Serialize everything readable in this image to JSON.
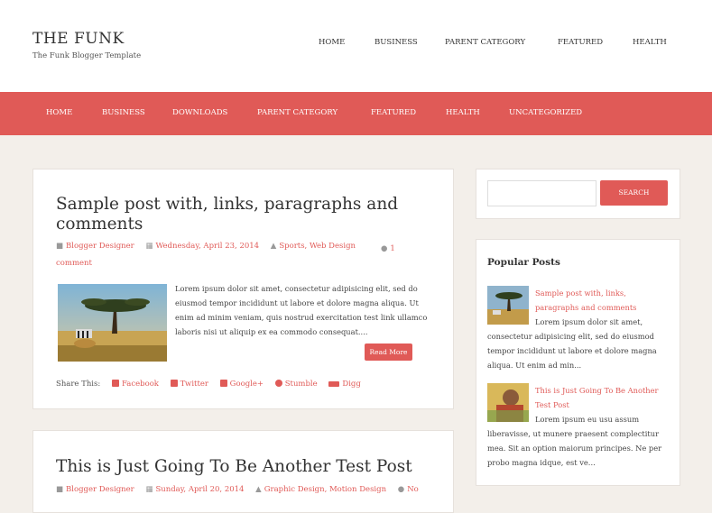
{
  "site": {
    "title": "THE FUNK",
    "description": "The Funk Blogger Template"
  },
  "top_nav": [
    "HOME",
    "BUSINESS",
    "PARENT CATEGORY",
    "FEATURED",
    "HEALTH"
  ],
  "main_nav": [
    "HOME",
    "BUSINESS",
    "DOWNLOADS",
    "PARENT CATEGORY",
    "FEATURED",
    "HEALTH",
    "UNCATEGORIZED"
  ],
  "posts": [
    {
      "title": "Sample post with, links, paragraphs and comments",
      "author": "Blogger Designer",
      "date": "Wednesday, April 23, 2014",
      "categories": "Sports, Web Design",
      "comments": "1 comment",
      "excerpt": "Lorem ipsum dolor sit amet, consectetur adipisicing elit, sed do eiusmod tempor incididunt ut labore et dolore magna aliqua. Ut enim ad minim veniam, quis nostrud exercitation test link ullamco laboris nisi ut aliquip ex ea commodo consequat....",
      "read_more": "Read More",
      "share_label": "Share This:",
      "share": [
        "Facebook",
        "Twitter",
        "Google+",
        "Stumble",
        "Digg"
      ]
    },
    {
      "title": "This is Just Going To Be Another Test Post",
      "author": "Blogger Designer",
      "date": "Sunday, April 20, 2014",
      "categories": "Graphic Design, Motion Design",
      "comments": "No"
    }
  ],
  "sidebar": {
    "search_button": "SEARCH",
    "popular_title": "Popular Posts",
    "popular": [
      {
        "title": "Sample post with, links, paragraphs and comments",
        "excerpt": "Lorem ipsum dolor sit amet, consectetur adipisicing elit, sed do eiusmod tempor incididunt ut labore et dolore magna aliqua. Ut enim ad min..."
      },
      {
        "title": "This is Just Going To Be Another Test Post",
        "excerpt": "Lorem ipsum eu usu assum liberavisse, ut munere praesent complectitur mea. Sit an option maiorum principes. Ne per probo magna idque, est ve..."
      }
    ]
  },
  "colors": {
    "accent": "#e05a57",
    "background": "#f3efea"
  }
}
